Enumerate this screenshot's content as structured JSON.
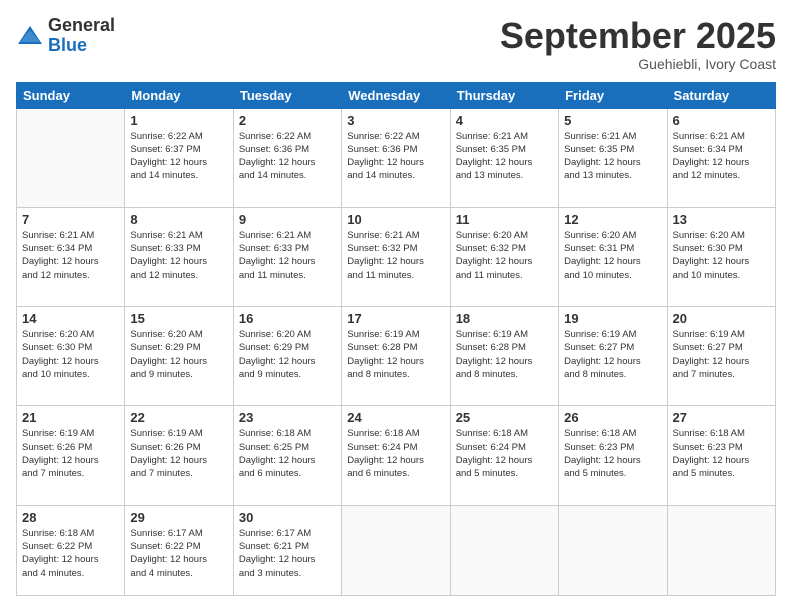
{
  "logo": {
    "general": "General",
    "blue": "Blue"
  },
  "header": {
    "month": "September 2025",
    "location": "Guehiebli, Ivory Coast"
  },
  "weekdays": [
    "Sunday",
    "Monday",
    "Tuesday",
    "Wednesday",
    "Thursday",
    "Friday",
    "Saturday"
  ],
  "weeks": [
    [
      {
        "day": "",
        "info": ""
      },
      {
        "day": "1",
        "info": "Sunrise: 6:22 AM\nSunset: 6:37 PM\nDaylight: 12 hours\nand 14 minutes."
      },
      {
        "day": "2",
        "info": "Sunrise: 6:22 AM\nSunset: 6:36 PM\nDaylight: 12 hours\nand 14 minutes."
      },
      {
        "day": "3",
        "info": "Sunrise: 6:22 AM\nSunset: 6:36 PM\nDaylight: 12 hours\nand 14 minutes."
      },
      {
        "day": "4",
        "info": "Sunrise: 6:21 AM\nSunset: 6:35 PM\nDaylight: 12 hours\nand 13 minutes."
      },
      {
        "day": "5",
        "info": "Sunrise: 6:21 AM\nSunset: 6:35 PM\nDaylight: 12 hours\nand 13 minutes."
      },
      {
        "day": "6",
        "info": "Sunrise: 6:21 AM\nSunset: 6:34 PM\nDaylight: 12 hours\nand 12 minutes."
      }
    ],
    [
      {
        "day": "7",
        "info": "Sunrise: 6:21 AM\nSunset: 6:34 PM\nDaylight: 12 hours\nand 12 minutes."
      },
      {
        "day": "8",
        "info": "Sunrise: 6:21 AM\nSunset: 6:33 PM\nDaylight: 12 hours\nand 12 minutes."
      },
      {
        "day": "9",
        "info": "Sunrise: 6:21 AM\nSunset: 6:33 PM\nDaylight: 12 hours\nand 11 minutes."
      },
      {
        "day": "10",
        "info": "Sunrise: 6:21 AM\nSunset: 6:32 PM\nDaylight: 12 hours\nand 11 minutes."
      },
      {
        "day": "11",
        "info": "Sunrise: 6:20 AM\nSunset: 6:32 PM\nDaylight: 12 hours\nand 11 minutes."
      },
      {
        "day": "12",
        "info": "Sunrise: 6:20 AM\nSunset: 6:31 PM\nDaylight: 12 hours\nand 10 minutes."
      },
      {
        "day": "13",
        "info": "Sunrise: 6:20 AM\nSunset: 6:30 PM\nDaylight: 12 hours\nand 10 minutes."
      }
    ],
    [
      {
        "day": "14",
        "info": "Sunrise: 6:20 AM\nSunset: 6:30 PM\nDaylight: 12 hours\nand 10 minutes."
      },
      {
        "day": "15",
        "info": "Sunrise: 6:20 AM\nSunset: 6:29 PM\nDaylight: 12 hours\nand 9 minutes."
      },
      {
        "day": "16",
        "info": "Sunrise: 6:20 AM\nSunset: 6:29 PM\nDaylight: 12 hours\nand 9 minutes."
      },
      {
        "day": "17",
        "info": "Sunrise: 6:19 AM\nSunset: 6:28 PM\nDaylight: 12 hours\nand 8 minutes."
      },
      {
        "day": "18",
        "info": "Sunrise: 6:19 AM\nSunset: 6:28 PM\nDaylight: 12 hours\nand 8 minutes."
      },
      {
        "day": "19",
        "info": "Sunrise: 6:19 AM\nSunset: 6:27 PM\nDaylight: 12 hours\nand 8 minutes."
      },
      {
        "day": "20",
        "info": "Sunrise: 6:19 AM\nSunset: 6:27 PM\nDaylight: 12 hours\nand 7 minutes."
      }
    ],
    [
      {
        "day": "21",
        "info": "Sunrise: 6:19 AM\nSunset: 6:26 PM\nDaylight: 12 hours\nand 7 minutes."
      },
      {
        "day": "22",
        "info": "Sunrise: 6:19 AM\nSunset: 6:26 PM\nDaylight: 12 hours\nand 7 minutes."
      },
      {
        "day": "23",
        "info": "Sunrise: 6:18 AM\nSunset: 6:25 PM\nDaylight: 12 hours\nand 6 minutes."
      },
      {
        "day": "24",
        "info": "Sunrise: 6:18 AM\nSunset: 6:24 PM\nDaylight: 12 hours\nand 6 minutes."
      },
      {
        "day": "25",
        "info": "Sunrise: 6:18 AM\nSunset: 6:24 PM\nDaylight: 12 hours\nand 5 minutes."
      },
      {
        "day": "26",
        "info": "Sunrise: 6:18 AM\nSunset: 6:23 PM\nDaylight: 12 hours\nand 5 minutes."
      },
      {
        "day": "27",
        "info": "Sunrise: 6:18 AM\nSunset: 6:23 PM\nDaylight: 12 hours\nand 5 minutes."
      }
    ],
    [
      {
        "day": "28",
        "info": "Sunrise: 6:18 AM\nSunset: 6:22 PM\nDaylight: 12 hours\nand 4 minutes."
      },
      {
        "day": "29",
        "info": "Sunrise: 6:17 AM\nSunset: 6:22 PM\nDaylight: 12 hours\nand 4 minutes."
      },
      {
        "day": "30",
        "info": "Sunrise: 6:17 AM\nSunset: 6:21 PM\nDaylight: 12 hours\nand 3 minutes."
      },
      {
        "day": "",
        "info": ""
      },
      {
        "day": "",
        "info": ""
      },
      {
        "day": "",
        "info": ""
      },
      {
        "day": "",
        "info": ""
      }
    ]
  ]
}
